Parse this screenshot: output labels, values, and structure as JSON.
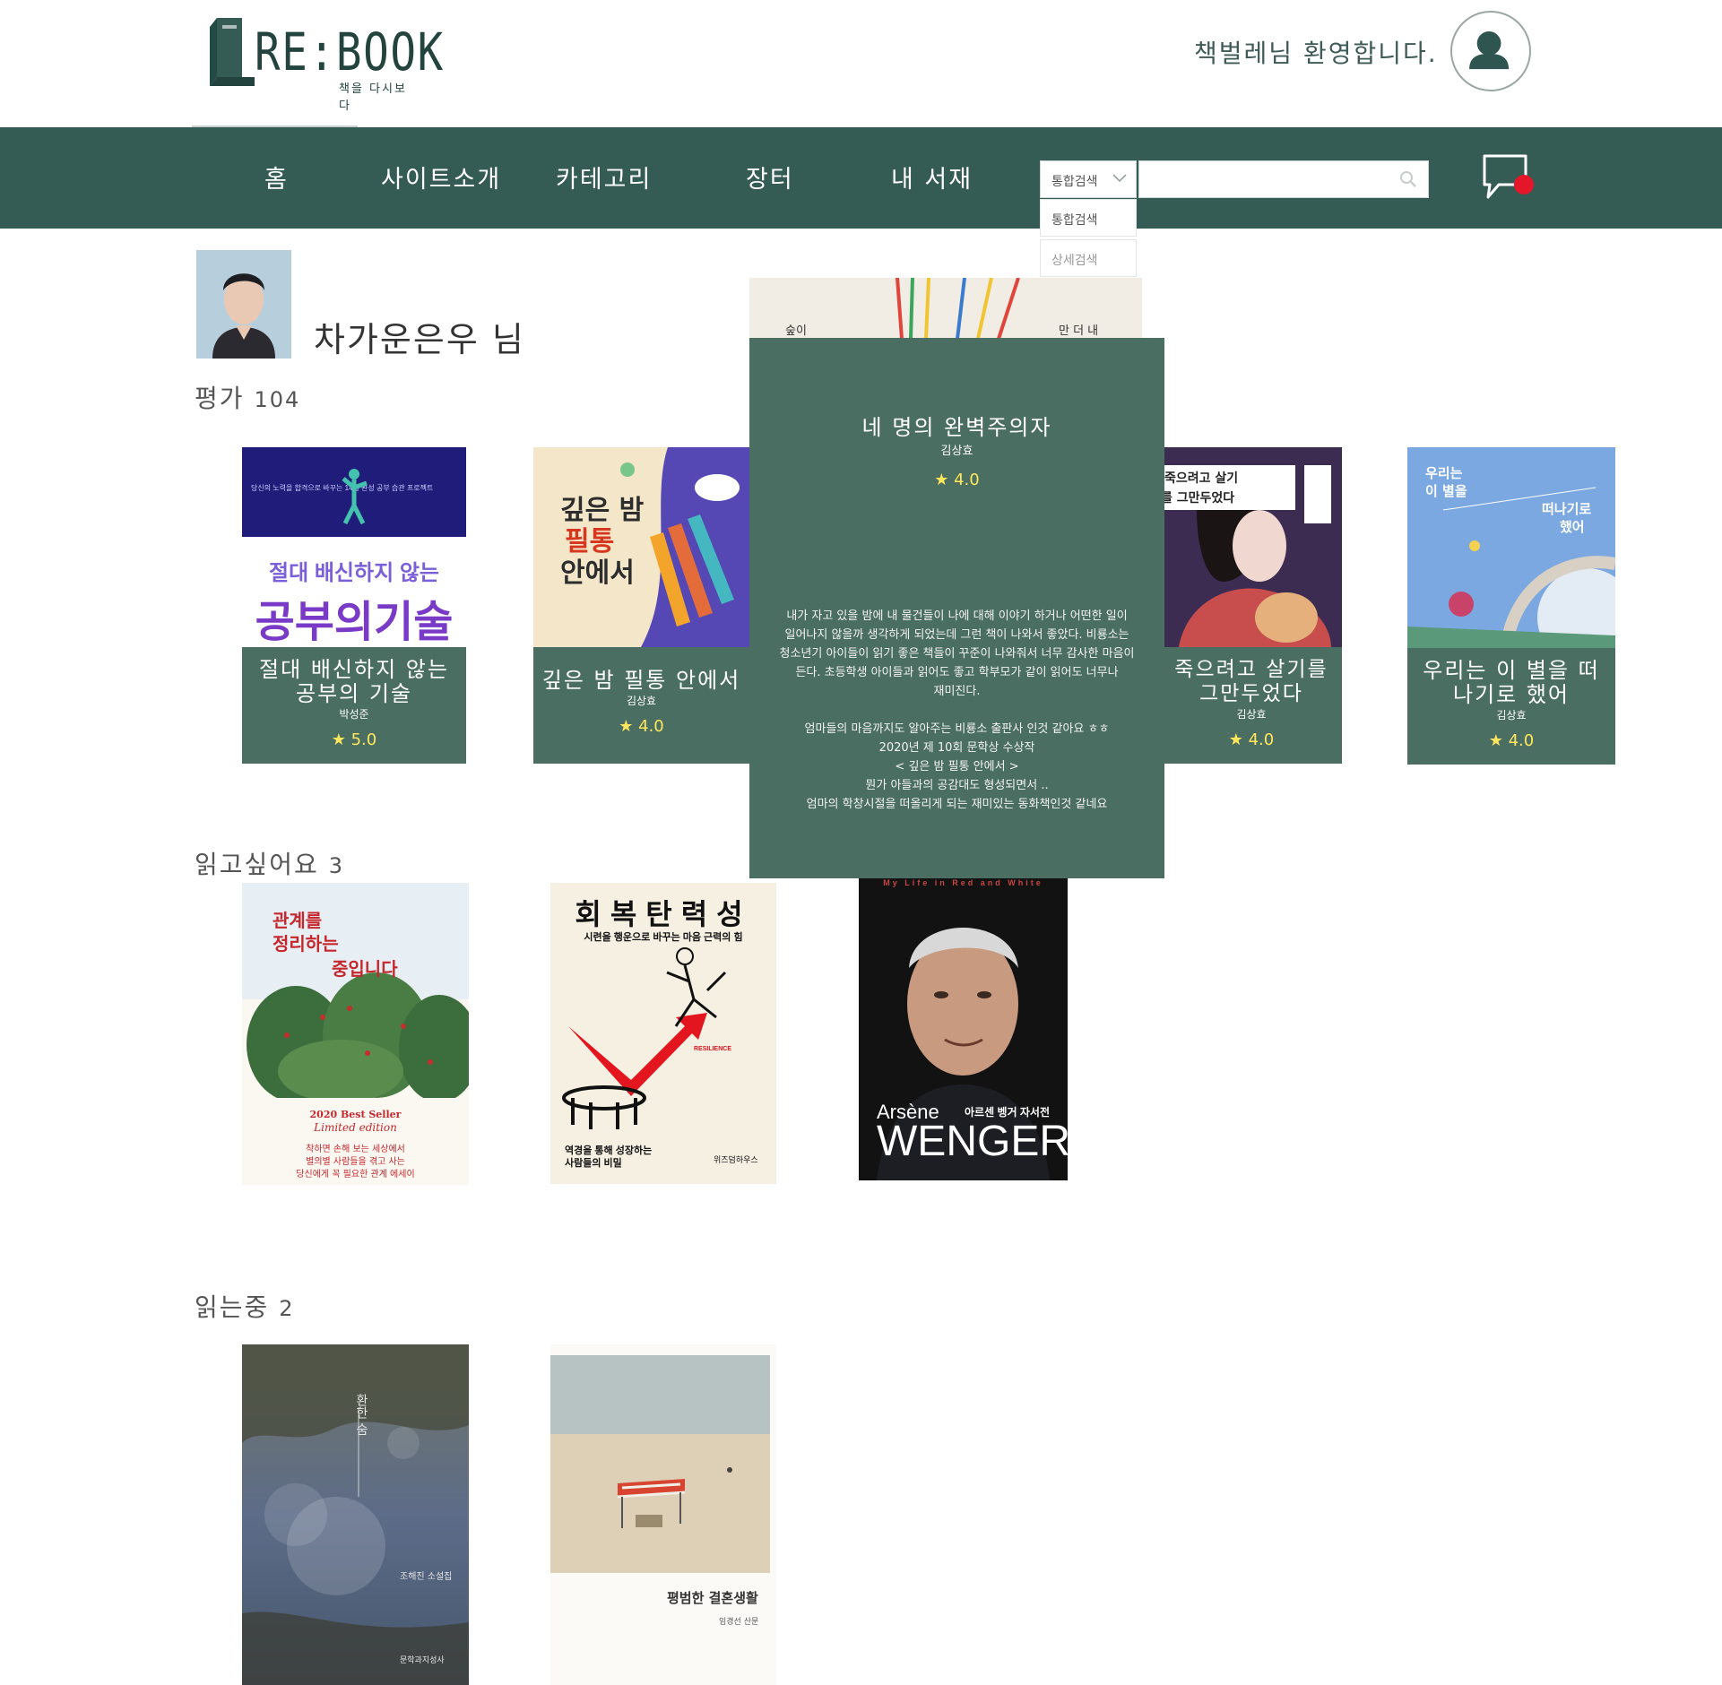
{
  "header": {
    "logo_text": "RE:BOOK",
    "logo_sub": "책을 다시보다",
    "welcome": "책벌레님 환영합니다."
  },
  "nav": {
    "items": [
      "홈",
      "사이트소개",
      "카테고리",
      "장터",
      "내 서재"
    ],
    "search": {
      "selected": "통합검색",
      "options": [
        "통합검색",
        "상세검색"
      ],
      "placeholder": ""
    }
  },
  "profile": {
    "name": "차가운은우 님"
  },
  "sections": {
    "rated": {
      "label": "평가",
      "count": "104"
    },
    "want": {
      "label": "읽고싶어요",
      "count": "3"
    },
    "reading": {
      "label": "읽는중",
      "count": "2"
    }
  },
  "rated_books": [
    {
      "title": "절대 배신하지 않는 공부의 기술",
      "author": "박성준",
      "rating": "★ 5.0",
      "cover_top": "당신의 노력을 합격으로 바꾸는 14일 완성 공부 습관 프로젝트",
      "cover_line1": "절대 배신하지 않는",
      "cover_line2": "공부의기술"
    },
    {
      "title": "깊은 밤 필통 안에서",
      "author": "김상효",
      "rating": "★ 4.0",
      "cover_line1": "깊은 밤",
      "cover_line2": "필통",
      "cover_line3": "안에서"
    },
    {
      "title": "죽으려고 살기를 그만두었다",
      "author": "김상효",
      "rating": "★ 4.0",
      "cover_line1": "죽으려고 살기",
      "cover_line2": "를 그만두었다"
    },
    {
      "title": "우리는 이 별을 떠나기로 했어",
      "author": "김상효",
      "rating": "★ 4.0",
      "cover_line1": "우리는",
      "cover_line2": "이 별을",
      "cover_line3": "떠나기로",
      "cover_line4": "했어"
    }
  ],
  "hover_book": {
    "title": "네 명의 완벽주의자",
    "author": "김상효",
    "rating": "★ 4.0",
    "review": [
      "내가 자고 있을 밤에 내 물건들이 나에 대해 이야기 하거나 어떤한 일이",
      "일어나지 않을까 생각하게 되었는데 그런 책이 나와서 좋았다. 비룡소는",
      "청소년기 아이들이 읽기 좋은 책들이 꾸준이 나와줘서 너무 감사한 마음이",
      "든다. 초등학생 아이들과 읽어도 좋고 학부모가 같이 읽어도 너무나",
      "재미진다.",
      "",
      "엄마들의 마음까지도 알아주는 비룡소 출판사 인것 같아요 ㅎㅎ",
      "2020년 제 10회 문학상 수상작",
      "< 깊은 밤 필통 안에서 >",
      "뭔가 아들과의 공감대도 형성되면서 ..",
      "엄마의 학창시절을 떠올리게 되는 재미있는 동화책인것 같네요"
    ],
    "peek_left": "숲이",
    "peek_right": "만 더 내"
  },
  "want_books": [
    {
      "title_line1": "관계를",
      "title_line2": "정리하는",
      "title_line3": "중입니다",
      "badge": "2020 Best Seller",
      "badge_sub": "Limited edition",
      "tag1": "착하면 손해 보는 세상에서",
      "tag2": "별의별 사람들을 겪고 사는",
      "tag3": "당신에게 꼭 필요한 관계 에세이"
    },
    {
      "title": "회복탄력성",
      "sub": "시련을 행운으로 바꾸는 마음 근력의 힘",
      "en": "RESILIENCE",
      "bottom1": "역경을 통해 성장하는",
      "bottom2": "사람들의 비밀",
      "pub": "위즈덤하우스"
    },
    {
      "top": "My Life in Red and White",
      "name1": "Arsène",
      "name2": "WENGER",
      "kr": "아르센 벵거 자서전"
    }
  ],
  "reading_books": [
    {
      "title": "환한 숨",
      "author": "조해진 소설집",
      "pub": "문학과지성사"
    },
    {
      "title": "평범한 결혼생활",
      "author": "임경선 산문"
    }
  ],
  "colors": {
    "nav_bg": "#355b55",
    "card_caption": "#4b6e63",
    "star": "#ffe65c",
    "notification": "#e3162a"
  },
  "icons": {
    "avatar": "user-icon",
    "search": "search-icon",
    "chat": "chat-bubble-icon",
    "dropdown": "chevron-down-icon"
  }
}
